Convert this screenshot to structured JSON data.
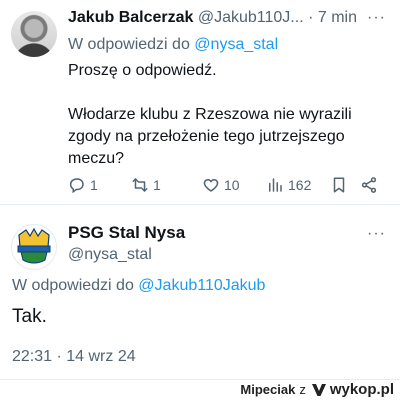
{
  "tweet1": {
    "author_name": "Jakub Balcerzak",
    "author_handle": "@Jakub110J...",
    "separator": "·",
    "time": "7 min",
    "more": "···",
    "reply_prefix": "W odpowiedzi do",
    "reply_to": "@nysa_stal",
    "text_p1": "Proszę o odpowiedź.",
    "text_p2": "Włodarze klubu z Rzeszowa nie wyrazili zgody na przełożenie tego jutrzejszego meczu?",
    "replies": "1",
    "retweets": "1",
    "likes": "10",
    "views": "162"
  },
  "tweet2": {
    "author_name": "PSG Stal Nysa",
    "author_handle": "@nysa_stal",
    "more": "···",
    "reply_prefix": "W odpowiedzi do",
    "reply_to": "@Jakub110Jakub",
    "text": "Tak.",
    "timestamp": "22:31 · 14 wrz 24"
  },
  "footer": {
    "user": "Mipeciak",
    "via": "z",
    "site": "wykop.pl"
  },
  "colors": {
    "link": "#1d9bf0",
    "muted": "#536471",
    "text": "#0f1419"
  }
}
